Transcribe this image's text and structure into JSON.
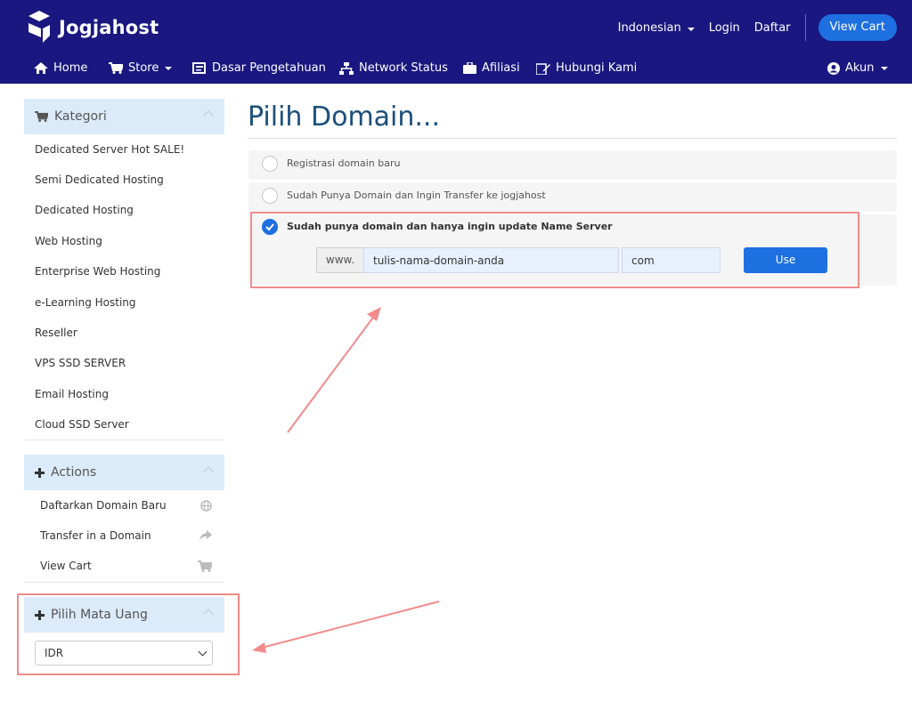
{
  "header": {
    "brand": "Jogjahost",
    "language": "Indonesian",
    "login": "Login",
    "register": "Daftar",
    "view_cart": "View Cart"
  },
  "nav": {
    "home": "Home",
    "store": "Store",
    "knowledgebase": "Dasar Pengetahuan",
    "network_status": "Network Status",
    "affiliate": "Afiliasi",
    "contact": "Hubungi Kami",
    "account": "Akun"
  },
  "sidebar": {
    "categories_title": "Kategori",
    "categories": [
      "Dedicated Server Hot SALE!",
      "Semi Dedicated Hosting",
      "Dedicated Hosting",
      "Web Hosting",
      "Enterprise Web Hosting",
      "e-Learning Hosting",
      "Reseller",
      "VPS SSD SERVER",
      "Email Hosting",
      "Cloud SSD Server"
    ],
    "actions_title": "Actions",
    "actions": [
      {
        "label": "Daftarkan Domain Baru",
        "icon": "globe-icon"
      },
      {
        "label": "Transfer in a Domain",
        "icon": "share-arrow-icon"
      },
      {
        "label": "View Cart",
        "icon": "cart-icon"
      }
    ],
    "currency_title": "Pilih Mata Uang",
    "currency_selected": "IDR"
  },
  "main": {
    "title": "Pilih Domain...",
    "options": [
      "Registrasi domain baru",
      "Sudah Punya Domain dan Ingin Transfer ke jogjahost",
      "Sudah punya domain dan hanya ingin update Name Server"
    ],
    "www_prefix": "www.",
    "domain_value": "tulis-nama-domain-anda",
    "tld_value": "com",
    "use_button": "Use"
  },
  "colors": {
    "header_bg": "#1a1780",
    "accent": "#1e6fe0",
    "annotation": "#f28b8b"
  }
}
